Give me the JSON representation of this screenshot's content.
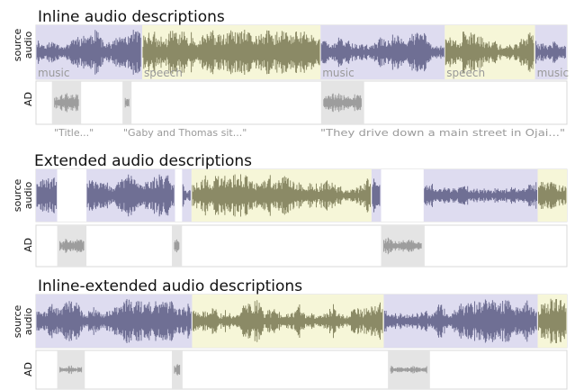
{
  "colors": {
    "music_bg": "#dedcf0",
    "music_wave": "#6f6f94",
    "speech_bg": "#f6f6d8",
    "speech_wave": "#8b8a66",
    "ad_bg": "#e4e4e4",
    "ad_wave": "#9d9d9d",
    "label_text": "#9a9a9a"
  },
  "track_labels": {
    "source_line1": "source",
    "source_line2": "audio",
    "ad": "AD"
  },
  "panels": [
    {
      "title": "Inline audio descriptions",
      "segments": [
        {
          "type": "music",
          "start": 0.0,
          "end": 0.2,
          "label": "music"
        },
        {
          "type": "speech",
          "start": 0.2,
          "end": 0.536,
          "label": "speech"
        },
        {
          "type": "music",
          "start": 0.536,
          "end": 0.77,
          "label": "music"
        },
        {
          "type": "speech",
          "start": 0.77,
          "end": 0.94,
          "label": "speech"
        },
        {
          "type": "music",
          "start": 0.94,
          "end": 1.0,
          "label": "music"
        }
      ],
      "gaps": [],
      "ad_clips": [
        {
          "start": 0.03,
          "end": 0.085
        },
        {
          "start": 0.163,
          "end": 0.18
        },
        {
          "start": 0.537,
          "end": 0.618
        }
      ],
      "quotes": [
        "\"Title...\"",
        "\"Gaby and Thomas sit...\"",
        "\"They drive down a main street in Ojai...\""
      ]
    },
    {
      "title": "Extended audio descriptions",
      "segments": [
        {
          "type": "music",
          "start": 0.0,
          "end": 0.04,
          "label": ""
        },
        {
          "type": "music",
          "start": 0.095,
          "end": 0.262,
          "label": ""
        },
        {
          "type": "music",
          "start": 0.275,
          "end": 0.293,
          "label": ""
        },
        {
          "type": "speech",
          "start": 0.293,
          "end": 0.632,
          "label": ""
        },
        {
          "type": "music",
          "start": 0.632,
          "end": 0.65,
          "label": ""
        },
        {
          "type": "music",
          "start": 0.73,
          "end": 0.945,
          "label": ""
        },
        {
          "type": "speech",
          "start": 0.945,
          "end": 1.0,
          "label": ""
        }
      ],
      "gaps": [
        {
          "start": 0.04,
          "end": 0.095
        },
        {
          "start": 0.262,
          "end": 0.275
        },
        {
          "start": 0.65,
          "end": 0.73
        }
      ],
      "ad_clips": [
        {
          "start": 0.04,
          "end": 0.095
        },
        {
          "start": 0.256,
          "end": 0.275
        },
        {
          "start": 0.65,
          "end": 0.732
        }
      ],
      "quotes": []
    },
    {
      "title": "Inline-extended audio descriptions",
      "segments": [
        {
          "type": "music",
          "start": 0.0,
          "end": 0.294,
          "label": ""
        },
        {
          "type": "speech",
          "start": 0.294,
          "end": 0.655,
          "label": ""
        },
        {
          "type": "music",
          "start": 0.655,
          "end": 0.945,
          "label": ""
        },
        {
          "type": "speech",
          "start": 0.945,
          "end": 1.0,
          "label": ""
        }
      ],
      "gaps": [],
      "ad_clips": [
        {
          "start": 0.04,
          "end": 0.092
        },
        {
          "start": 0.256,
          "end": 0.276
        },
        {
          "start": 0.663,
          "end": 0.742
        }
      ],
      "quotes": []
    }
  ]
}
